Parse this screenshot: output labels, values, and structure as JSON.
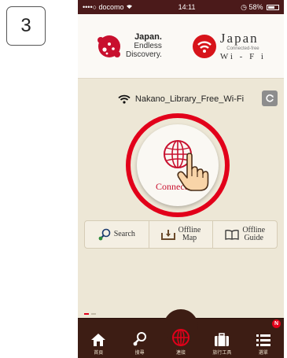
{
  "step_number": "3",
  "status_bar": {
    "carrier": "••••○ docomo",
    "time": "14:11",
    "battery": "58%"
  },
  "logos": {
    "jnto_line1": "Japan.",
    "jnto_line2": "Endless",
    "jnto_line3": "Discovery.",
    "wifi_title": "Japan",
    "wifi_sub": "Connected-free",
    "wifi_bottom": "Wi - F i"
  },
  "network": {
    "ssid": "Nakano_Library_Free_Wi-Fi"
  },
  "connect_button": {
    "label": "Connect"
  },
  "shortcuts": [
    {
      "label": "Search"
    },
    {
      "label_line1": "Offline",
      "label_line2": "Map"
    },
    {
      "label_line1": "Offline",
      "label_line2": "Guide"
    }
  ],
  "tabs": [
    {
      "label": "首頁"
    },
    {
      "label": "搜尋"
    },
    {
      "label": "連接"
    },
    {
      "label": "旅行工具"
    },
    {
      "label": "選單",
      "badge": "N"
    }
  ],
  "colors": {
    "accent_red": "#e2001a",
    "statusbar": "#4b1a1a",
    "tabbar": "#3d1d14",
    "background": "#ede7d6"
  }
}
